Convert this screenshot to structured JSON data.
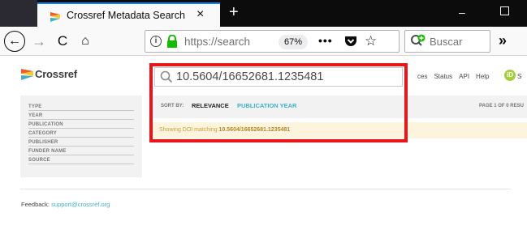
{
  "browser": {
    "tab_title": "Crossref Metadata Search",
    "tab_close": "×",
    "new_tab": "+",
    "url_text": "https://search",
    "zoom": "67%",
    "more_actions": "•••",
    "search_placeholder": "Buscar",
    "overflow": "»",
    "minimize": "–",
    "nav": {
      "back": "←",
      "forward": "→",
      "reload": "C",
      "home": "⌂"
    }
  },
  "site": {
    "logo_text": "Crossref",
    "search_query": "10.5604/16652681.1235481",
    "top_links": [
      "ces",
      "Status",
      "API",
      "Help"
    ],
    "orcid_badge": "iD",
    "orcid_after": "S",
    "facets": [
      "TYPE",
      "YEAR",
      "PUBLICATION",
      "CATEGORY",
      "PUBLISHER",
      "FUNDER NAME",
      "SOURCE"
    ],
    "sort": {
      "label": "SORT BY:",
      "relevance": "RELEVANCE",
      "publication_year": "PUBLICATION YEAR"
    },
    "page_info": "PAGE 1 OF 0 RESU",
    "doi_banner": {
      "prefix": "Showing DOI matching ",
      "doi": "10.5604/16652681.1235481"
    },
    "feedback": {
      "label": "Feedback: ",
      "link": "support@crossref.org"
    }
  },
  "colors": {
    "highlight": "#e8151b",
    "link": "#3eb1c8",
    "banner_bg": "#fcf4dc",
    "tab_accent": "#0a84ff"
  }
}
